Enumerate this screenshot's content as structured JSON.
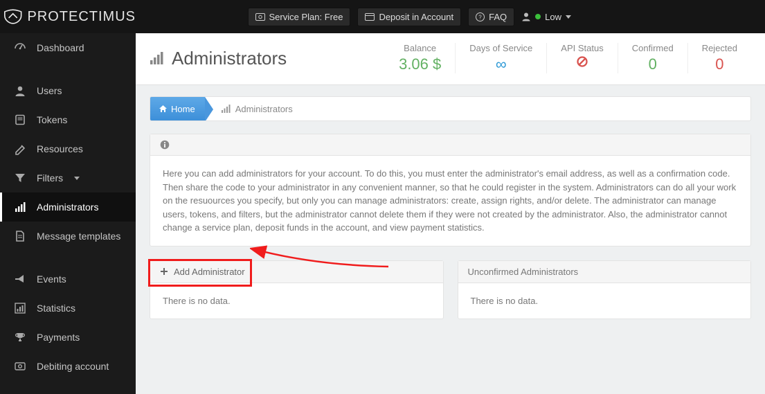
{
  "brand": "PROTECTIMUS",
  "topbar": {
    "service_plan": "Service Plan: Free",
    "deposit": "Deposit in Account",
    "faq": "FAQ",
    "user_level": "Low"
  },
  "sidebar": {
    "dashboard": "Dashboard",
    "users": "Users",
    "tokens": "Tokens",
    "resources": "Resources",
    "filters": "Filters",
    "administrators": "Administrators",
    "message_templates": "Message templates",
    "events": "Events",
    "statistics": "Statistics",
    "payments": "Payments",
    "debiting": "Debiting account"
  },
  "page": {
    "title": "Administrators",
    "stats": {
      "balance_label": "Balance",
      "balance_value": "3.06 $",
      "days_label": "Days of Service",
      "api_label": "API Status",
      "confirmed_label": "Confirmed",
      "confirmed_value": "0",
      "rejected_label": "Rejected",
      "rejected_value": "0"
    },
    "breadcrumb_home": "Home",
    "breadcrumb_current": "Administrators",
    "info_text": "Here you can add administrators for your account. To do this, you must enter the administrator's email address, as well as a confirmation code. Then share the code to your administrator in any convenient manner, so that he could register in the system. Administrators can do all your work on the resuources you specify, but only you can manage administrators: create, assign rights, and/or delete. The administrator can manage users, tokens, and filters, but the administrator cannot delete them if they were not created by the administrator. Also, the administrator cannot change a service plan, deposit funds in the account, and view payment statistics.",
    "add_admin": "Add Administrator",
    "unconfirmed": "Unconfirmed Administrators",
    "no_data": "There is no data."
  }
}
